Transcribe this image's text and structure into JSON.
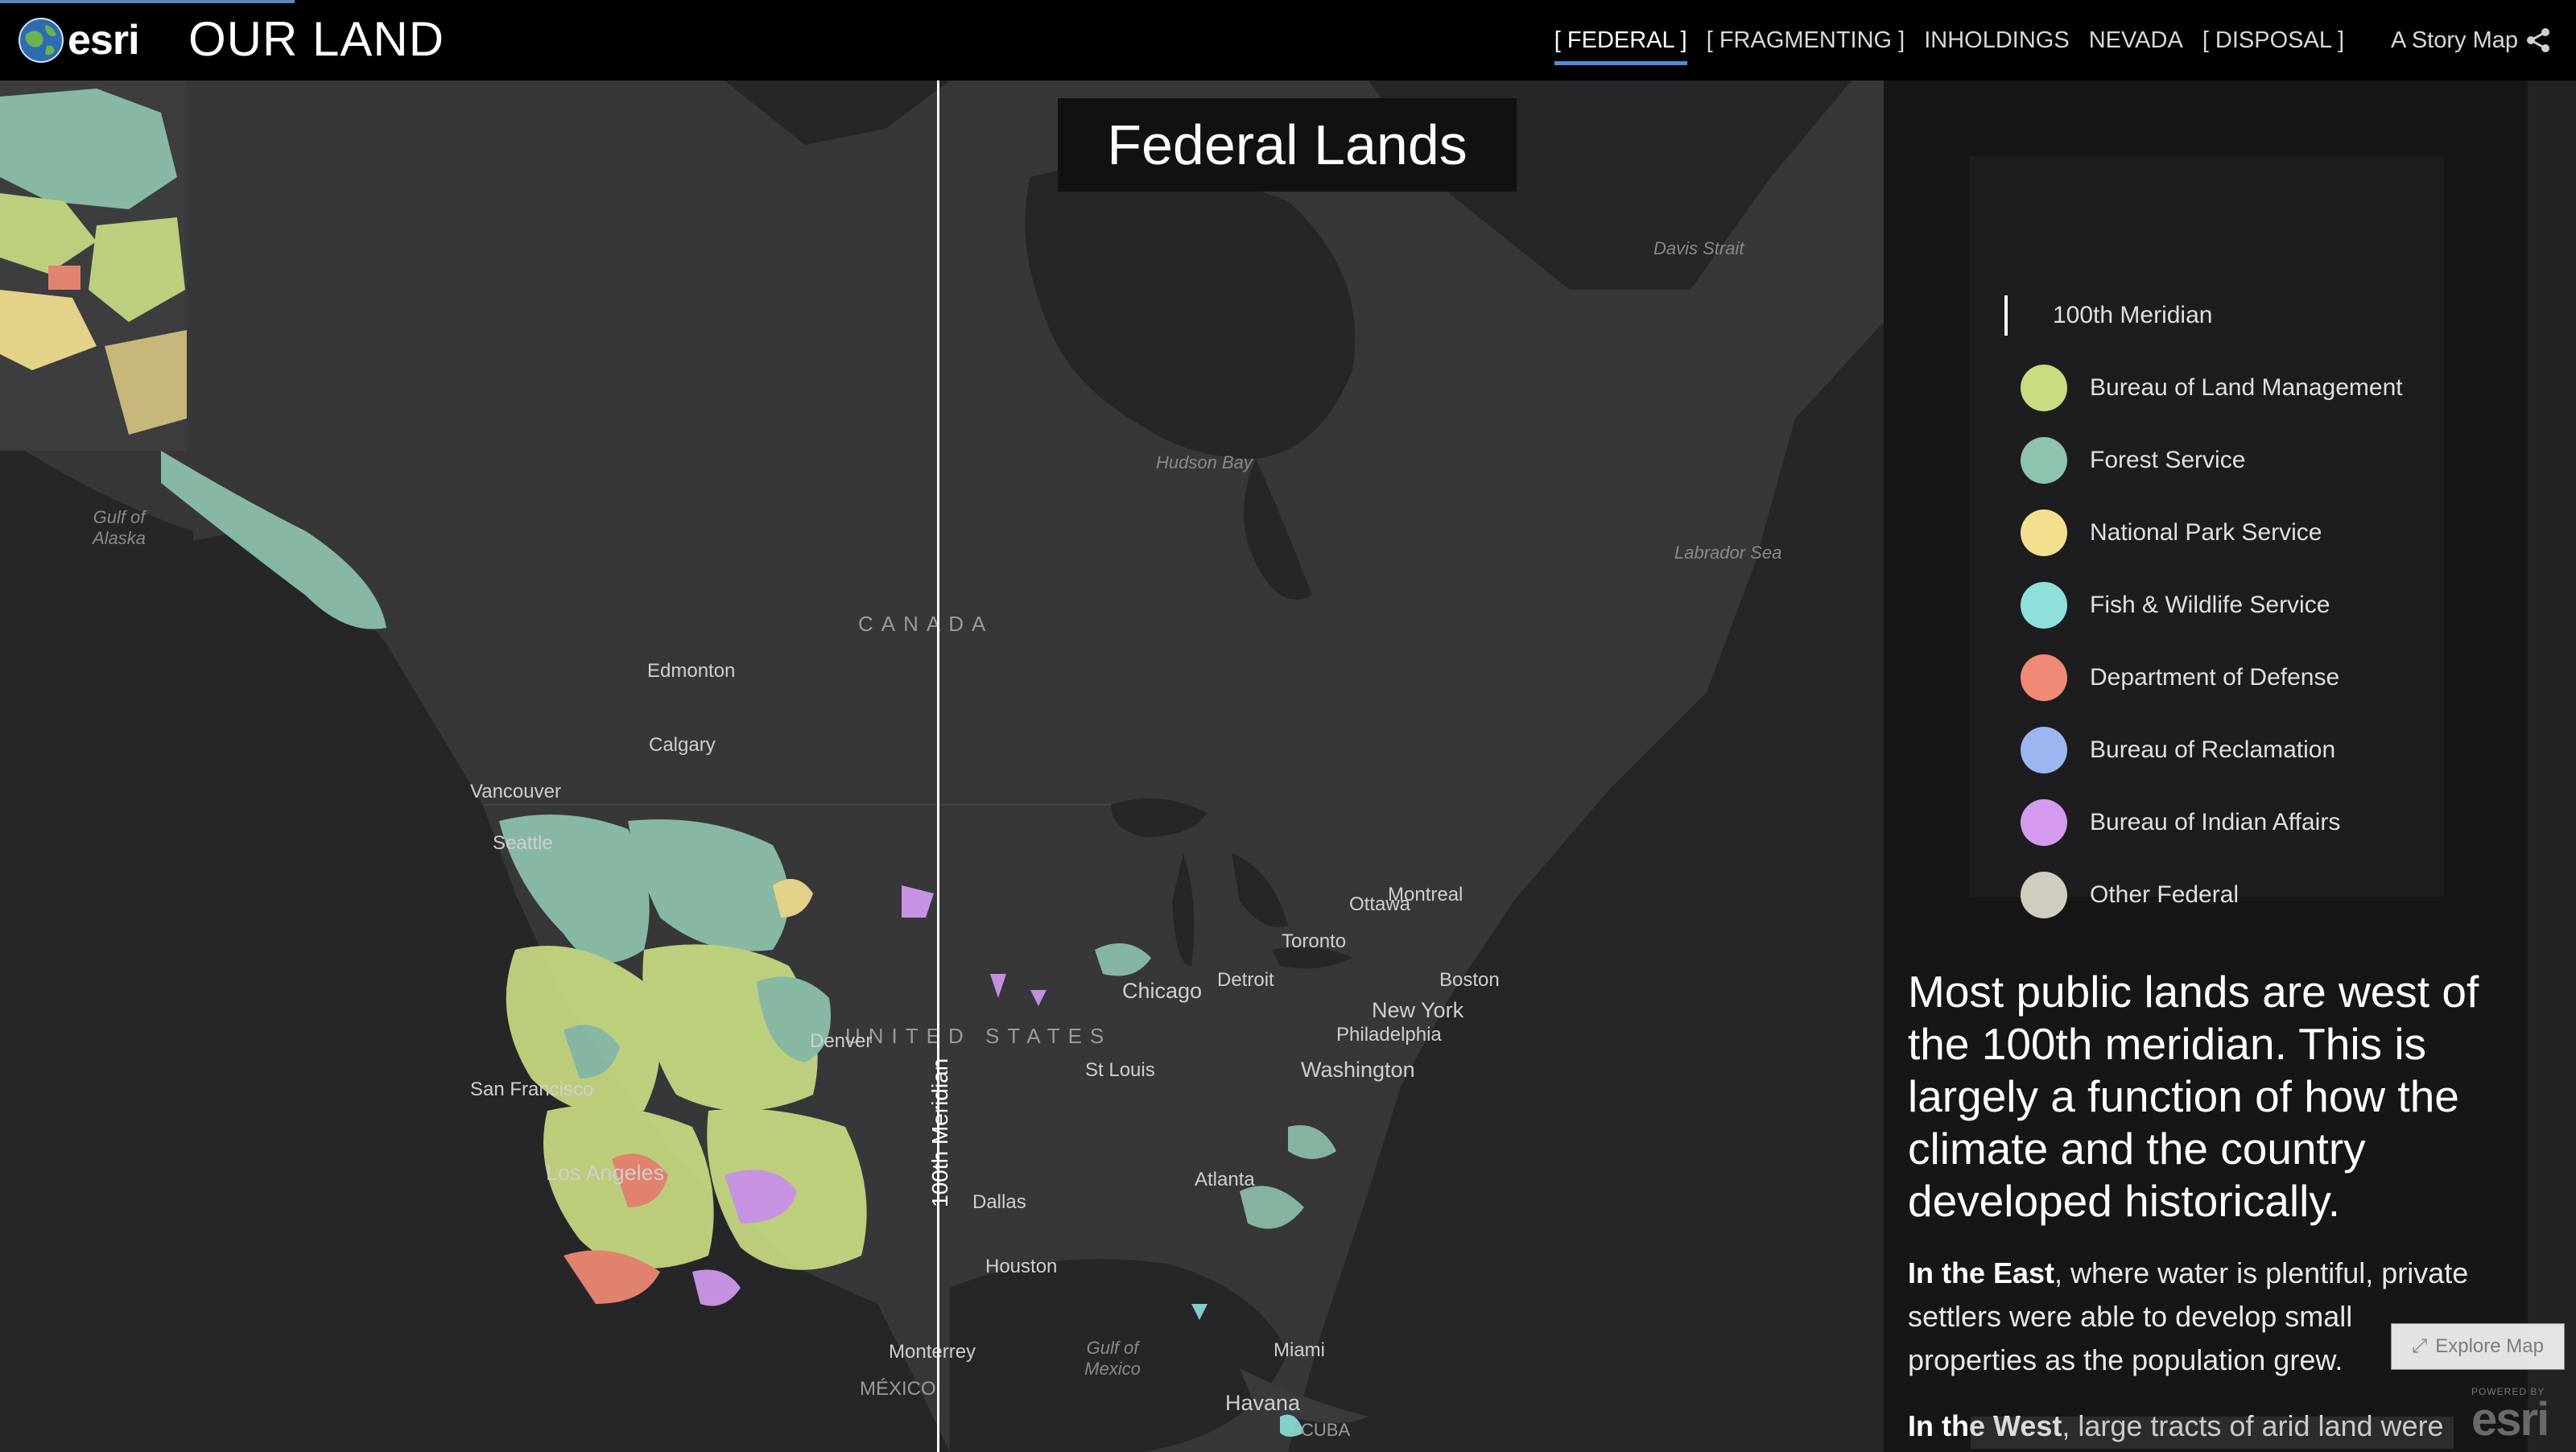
{
  "header": {
    "logo_text": "esri",
    "title": "OUR LAND",
    "tabs": [
      {
        "label": "[ FEDERAL ]",
        "active": true
      },
      {
        "label": "[ FRAGMENTING ]",
        "active": false
      },
      {
        "label": "INHOLDINGS",
        "active": false
      },
      {
        "label": "NEVADA",
        "active": false
      },
      {
        "label": "[ DISPOSAL ]",
        "active": false
      }
    ],
    "story_link": "A Story Map",
    "share_icon": "share-icon"
  },
  "map": {
    "title": "Federal Lands",
    "meridian_label": "100th Meridian",
    "labels": {
      "gulf_alaska": "Gulf of Alaska",
      "hudson_bay": "Hudson Bay",
      "davis_strait": "Davis Strait",
      "labrador_sea": "Labrador Sea",
      "canada": "CANADA",
      "edmonton": "Edmonton",
      "calgary": "Calgary",
      "vancouver": "Vancouver",
      "seattle": "Seattle",
      "ottawa": "Ottawa",
      "montreal": "Montreal",
      "toronto": "Toronto",
      "detroit": "Detroit",
      "boston": "Boston",
      "chicago": "Chicago",
      "new_york": "New York",
      "philadelphia": "Philadelphia",
      "united_states": "UNITED STATES",
      "denver": "Denver",
      "st_louis": "St Louis",
      "washington": "Washington",
      "san_francisco": "San Francisco",
      "los_angeles": "Los Angeles",
      "atlanta": "Atlanta",
      "dallas": "Dallas",
      "houston": "Houston",
      "monterrey": "Monterrey",
      "mexico": "MÉXICO",
      "gulf_mexico": "Gulf of Mexico",
      "miami": "Miami",
      "havana": "Havana",
      "cuba": "CUBA"
    }
  },
  "legend": {
    "meridian_label": "100th Meridian",
    "items": [
      {
        "label": "Bureau of Land Management",
        "color": "#c8dc82"
      },
      {
        "label": "Forest Service",
        "color": "#8ec3ad"
      },
      {
        "label": "National Park Service",
        "color": "#f2e08e"
      },
      {
        "label": "Fish & Wildlife Service",
        "color": "#8ee0da"
      },
      {
        "label": "Department of Defense",
        "color": "#f08a74"
      },
      {
        "label": "Bureau of Reclamation",
        "color": "#9bb6f0"
      },
      {
        "label": "Bureau of Indian Affairs",
        "color": "#d49af0"
      },
      {
        "label": "Other Federal",
        "color": "#cfcdbd"
      }
    ]
  },
  "narrative": {
    "lead": "Most public lands are west of the 100th meridian. This is largely a function of how the climate and the country developed historically.",
    "p1_bold": "In the East",
    "p1_rest": ", where water is plentiful, private settlers were able to develop small properties as the population grew.",
    "p2_bold": "In the West",
    "p2_rest": ", large tracts of arid land were"
  },
  "controls": {
    "explore_map": "Explore Map",
    "powered_by": "POWERED BY",
    "powered_brand": "esri"
  }
}
